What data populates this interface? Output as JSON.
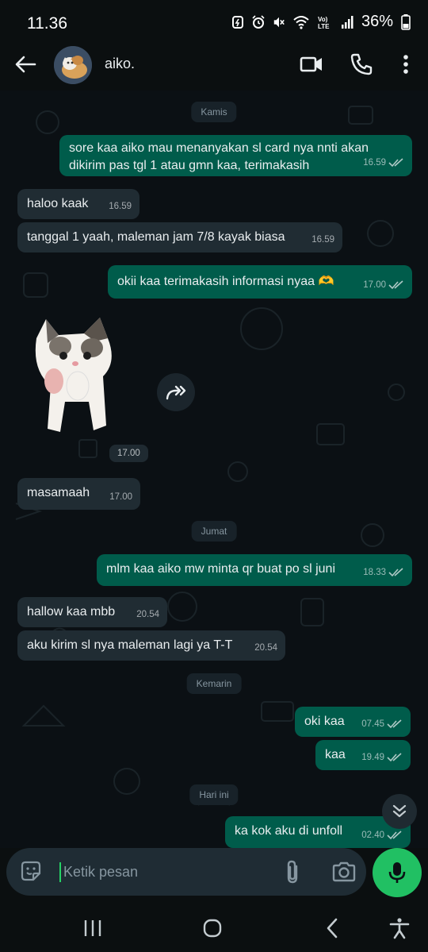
{
  "status_bar": {
    "time": "11.36",
    "battery": "36%",
    "icons": [
      "data-saver-icon",
      "alarm-icon",
      "mute-icon",
      "wifi-icon",
      "volte-icon",
      "signal-icon",
      "battery-icon"
    ]
  },
  "header": {
    "contact_name": "aiko.",
    "icons": [
      "back-arrow-icon",
      "avatar",
      "video-call-icon",
      "phone-icon",
      "more-vert-icon"
    ]
  },
  "chat": {
    "dates": {
      "d1": "Kamis",
      "d2": "Jumat",
      "d3": "Kemarin",
      "d4": "Hari ini"
    },
    "messages": {
      "m1": {
        "text_line1": "sore kaa aiko mau menanyakan sl card nya nnti akan",
        "text_line2": "dikirim pas tgl 1 atau gmn kaa, terimakasih",
        "time": "16.59",
        "direction": "out"
      },
      "m2": {
        "text": "haloo kaak",
        "time": "16.59",
        "direction": "in"
      },
      "m3": {
        "text": "tanggal 1 yaah, maleman jam 7/8 kayak biasa",
        "time": "16.59",
        "direction": "in"
      },
      "m4": {
        "text": "okii kaa terimakasih informasi nyaa 🫶",
        "time": "17.00",
        "direction": "out"
      },
      "m5": {
        "sticker": "cat-sticker",
        "time": "17.00",
        "direction": "in"
      },
      "m6": {
        "text": "masamaah",
        "time": "17.00",
        "direction": "in"
      },
      "m7": {
        "text": "mlm kaa aiko mw minta qr buat po sl juni",
        "time": "18.33",
        "direction": "out"
      },
      "m8": {
        "text": "hallow kaa mbb",
        "time": "20.54",
        "direction": "in"
      },
      "m9": {
        "text": "aku kirim sl nya maleman lagi ya T-T",
        "time": "20.54",
        "direction": "in"
      },
      "m10": {
        "text": "oki kaa",
        "time": "07.45",
        "direction": "out"
      },
      "m11": {
        "text": "kaa",
        "time": "19.49",
        "direction": "out"
      },
      "m12": {
        "text": "ka kok aku di unfoll",
        "time": "02.40",
        "direction": "out"
      }
    }
  },
  "input": {
    "placeholder": "Ketik pesan",
    "value": ""
  },
  "colors": {
    "accent": "#21c063",
    "outgoing_bubble": "#005c4b",
    "incoming_bubble": "#202c33",
    "background": "#0b1014"
  }
}
